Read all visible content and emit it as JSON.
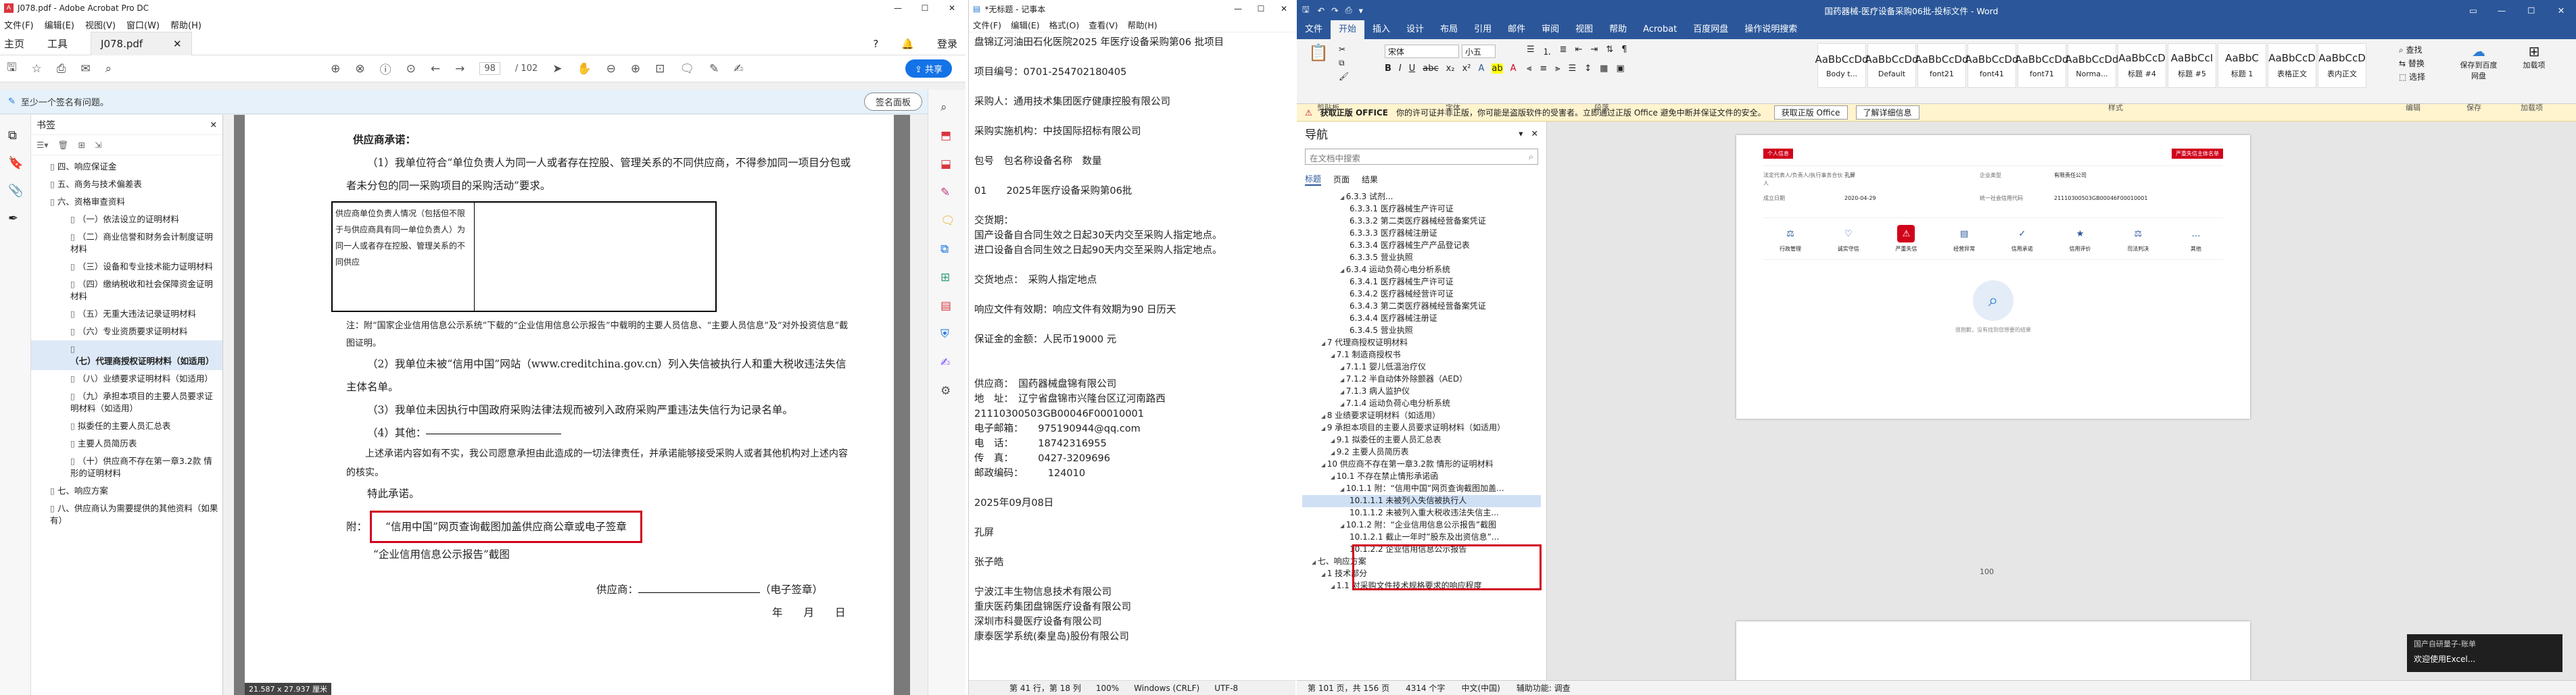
{
  "acrobat": {
    "title": "J078.pdf - Adobe Acrobat Pro DC",
    "menu": [
      "文件(F)",
      "编辑(E)",
      "视图(V)",
      "窗口(W)",
      "帮助(H)"
    ],
    "tabs": [
      "主页",
      "工具",
      "J078.pdf"
    ],
    "login": "登录",
    "page_current": "98",
    "page_total": "/ 102",
    "share": "共享",
    "notice": "至少一个签名有问题。",
    "sign_panel": "签名面板",
    "bookmarks_title": "书签",
    "bookmarks": [
      {
        "label": "四、响应保证金",
        "level": 1,
        "bold": false
      },
      {
        "label": "五、商务与技术偏差表",
        "level": 1,
        "bold": false
      },
      {
        "label": "六、资格审查资料",
        "level": 1,
        "bold": false
      },
      {
        "label": "（一）依法设立的证明材料",
        "level": 2,
        "bold": false
      },
      {
        "label": "（二）商业信誉和财务会计制度证明材料",
        "level": 2,
        "bold": false
      },
      {
        "label": "（三）设备和专业技术能力证明材料",
        "level": 2,
        "bold": false
      },
      {
        "label": "（四）缴纳税收和社会保障资金证明材料",
        "level": 2,
        "bold": false
      },
      {
        "label": "（五）无重大违法记录证明材料",
        "level": 2,
        "bold": false
      },
      {
        "label": "（六）专业资质要求证明材料",
        "level": 2,
        "bold": false
      },
      {
        "label": "（七）代理商授权证明材料（如适用）",
        "level": 2,
        "bold": true
      },
      {
        "label": "（八）业绩要求证明材料（如适用）",
        "level": 2,
        "bold": false
      },
      {
        "label": "（九）承担本项目的主要人员要求证明材料（如适用）",
        "level": 2,
        "bold": false
      },
      {
        "label": "拟委任的主要人员汇总表",
        "level": 2,
        "bold": false
      },
      {
        "label": "主要人员简历表",
        "level": 2,
        "bold": false
      },
      {
        "label": "（十）供应商不存在第一章3.2款 情形的证明材料",
        "level": 2,
        "bold": false
      },
      {
        "label": "七、响应方案",
        "level": 1,
        "bold": false
      },
      {
        "label": "八、供应商认为需要提供的其他资料（如果有）",
        "level": 1,
        "bold": false
      }
    ],
    "page": {
      "heading": "供应商承诺：",
      "p1": "（1）我单位符合“单位负责人为同一人或者存在控股、管理关系的不同供应商，不得参加同一项目分包或者未分包的同一采购项目的采购活动”要求。",
      "table_left": "供应商单位负责人情况（包括但不限于与供应商具有同一单位负责人）为同一人或者存在控股、管理关系的不同供应",
      "note": "注：附“国家企业信用信息公示系统”下载的“企业信用信息公示报告”中载明的主要人员信息、“主要人员信息”及“对外投资信息”截图证明。",
      "p2": "（2）我单位未被“信用中国”网站（www.creditchina.gov.cn）列入失信被执行人和重大税收违法失信主体名单。",
      "p3": "（3）我单位未因执行中国政府采购法律法规而被列入政府采购严重违法失信行为记录名单。",
      "p4": "（4）其他：",
      "p5": "上述承诺内容如有不实，我公司愿意承担由此造成的一切法律责任，并承诺能够接受采购人或者其他机构对上述内容的核实。",
      "p6": "特此承诺。",
      "att_prefix": "附：",
      "att1": "“信用中国”网页查询截图加盖供应商公章或电子签章",
      "att2": "“企业信用信息公示报告”截图",
      "sign": "供应商：",
      "sign_suffix": "（电子签章）",
      "date": "年　　月　　日"
    },
    "page_size": "21.587 x 27.937 厘米"
  },
  "notepad": {
    "title": "*无标题 - 记事本",
    "menu": [
      "文件(F)",
      "编辑(E)",
      "格式(O)",
      "查看(V)",
      "帮助(H)"
    ],
    "lines": [
      "盘锦辽河油田石化医院2025 年医疗设备采购第06 批项目",
      "",
      "项目编号：0701-254702180405",
      "",
      "采购人：通用技术集团医疗健康控股有限公司",
      "",
      "采购实施机构：中技国际招标有限公司",
      "",
      "包号　包名称设备名称　数量",
      "",
      "01　　2025年医疗设备采购第06批",
      "",
      "交货期：",
      "国产设备自合同生效之日起30天内交至采购人指定地点。",
      "进口设备自合同生效之日起90天内交至采购人指定地点。",
      "",
      "交货地点：　采购人指定地点",
      "",
      "响应文件有效期：响应文件有效期为90 日历天",
      "",
      "保证金的金额：人民币19000 元",
      "",
      "",
      "供应商：　国药器械盘锦有限公司",
      "地　址：　辽宁省盘锦市兴隆台区辽河南路西",
      "21110300503GB00046F00010001",
      "电子邮箱：　　975190944@qq.com",
      "电　话：　　　18742316955",
      "传　真：　　　0427-3209696",
      "邮政编码：　　　124010",
      "",
      "2025年09月08日",
      "",
      "孔屏",
      "",
      "张子皓",
      "",
      "宁波江丰生物信息技术有限公司",
      "重庆医药集团盘锦医疗设备有限公司",
      "深圳市科曼医疗设备有限公司",
      "康泰医学系统(秦皇岛)股份有限公司"
    ],
    "status": [
      "第 41 行，第 18 列",
      "100%",
      "Windows (CRLF)",
      "UTF-8"
    ]
  },
  "word": {
    "title": "国药器械-医疗设备采购06批-投标文件 - Word",
    "tabs": [
      "文件",
      "开始",
      "插入",
      "设计",
      "布局",
      "引用",
      "邮件",
      "审阅",
      "视图",
      "帮助",
      "Acrobat",
      "百度网盘",
      "操作说明搜索"
    ],
    "active_tab": "开始",
    "font_name": "宋体",
    "font_size": "小五",
    "styles": [
      {
        "preview": "AaBbCcDd",
        "label": "Body t..."
      },
      {
        "preview": "AaBbCcDd",
        "label": "Default"
      },
      {
        "preview": "AaBbCcDd",
        "label": "font21"
      },
      {
        "preview": "AaBbCcDd",
        "label": "font41"
      },
      {
        "preview": "AaBbCcDd",
        "label": "font71"
      },
      {
        "preview": "AaBbCcDd",
        "label": "Norma..."
      },
      {
        "preview": "AaBbCcD",
        "label": "标题 #4"
      },
      {
        "preview": "AaBbCcI",
        "label": "标题 #5"
      },
      {
        "preview": "AaBbC",
        "label": "标题 1"
      },
      {
        "preview": "AaBbCcD",
        "label": "表格正文"
      },
      {
        "preview": "AaBbCcD",
        "label": "表内正文"
      }
    ],
    "groups": [
      "剪贴板",
      "字体",
      "段落",
      "样式",
      "编辑",
      "保存",
      "加载项"
    ],
    "find": "查找",
    "replace": "替换",
    "select": "选择",
    "save_btn": "保存到百度网盘",
    "addins": "加载项",
    "msg_bold": "获取正版 OFFICE",
    "msg": "你的许可证并非正版，你可能是盗版软件的受害者。立即通过正版 Office 避免中断并保证文件的安全。",
    "msg_btn1": "获取正版 Office",
    "msg_btn2": "了解详细信息",
    "nav_title": "导航",
    "nav_search": "在文档中搜索",
    "nav_tabs": [
      "标题",
      "页面",
      "结果"
    ],
    "nav_items": [
      {
        "t": "6.3.3 试剂...",
        "l": 4
      },
      {
        "t": "6.3.3.1 医疗器械生产许可证",
        "l": 5
      },
      {
        "t": "6.3.3.2 第二类医疗器械经营备案凭证",
        "l": 5
      },
      {
        "t": "6.3.3.3 医疗器械注册证",
        "l": 5
      },
      {
        "t": "6.3.3.4 医疗器械生产产品登记表",
        "l": 5
      },
      {
        "t": "6.3.3.5 营业执照",
        "l": 5
      },
      {
        "t": "6.3.4 运动负荷心电分析系统",
        "l": 4
      },
      {
        "t": "6.3.4.1 医疗器械生产许可证",
        "l": 5
      },
      {
        "t": "6.3.4.2 医疗器械经营许可证",
        "l": 5
      },
      {
        "t": "6.3.4.3 第二类医疗器械经营备案凭证",
        "l": 5
      },
      {
        "t": "6.3.4.4 医疗器械注册证",
        "l": 5
      },
      {
        "t": "6.3.4.5 营业执照",
        "l": 5
      },
      {
        "t": "7 代理商授权证明材料",
        "l": 2
      },
      {
        "t": "7.1 制造商授权书",
        "l": 3
      },
      {
        "t": "7.1.1 婴儿低温治疗仪",
        "l": 4
      },
      {
        "t": "7.1.2 半自动体外除颤器（AED）",
        "l": 4
      },
      {
        "t": "7.1.3 病人监护仪",
        "l": 4
      },
      {
        "t": "7.1.4 运动负荷心电分析系统",
        "l": 4
      },
      {
        "t": "8 业绩要求证明材料（如适用）",
        "l": 2
      },
      {
        "t": "9 承担本项目的主要人员要求证明材料（如适用）",
        "l": 2
      },
      {
        "t": "9.1 拟委任的主要人员汇总表",
        "l": 3
      },
      {
        "t": "9.2 主要人员简历表",
        "l": 3
      },
      {
        "t": "10 供应商不存在第一章3.2款 情形的证明材料",
        "l": 2
      },
      {
        "t": "10.1 不存在禁止情形承诺函",
        "l": 3
      },
      {
        "t": "10.1.1 附：“信用中国”网页查询截图加盖...",
        "l": 4
      },
      {
        "t": "10.1.1.1 未被列入失信被执行人",
        "l": 5
      },
      {
        "t": "10.1.1.2 未被列入重大税收违法失信主...",
        "l": 5
      },
      {
        "t": "10.1.2 附：“企业信用信息公示报告”截图",
        "l": 4
      },
      {
        "t": "10.1.2.1 截止一年时”股东及出资信息”...",
        "l": 5
      },
      {
        "t": "10.1.2.2 企业信用信息公示报告",
        "l": 5
      },
      {
        "t": "七、响应方案",
        "l": 1
      },
      {
        "t": "1 技术部分",
        "l": 2
      },
      {
        "t": "1.1 对采购文件技术规格要求的响应程度",
        "l": 3
      }
    ],
    "nav_selected": "10.1.1.1 未被列入失信被执行人",
    "credit_page": {
      "badge": "个人信息",
      "company_label": "法定代表人/负责人/执行事务合伙人",
      "company_value": "孔屏",
      "type_label": "企业类型",
      "type_value": "有限责任公司",
      "date_label": "成立日期",
      "date_value": "2020-04-29",
      "code_label": "统一社会信用代码",
      "code_value": "21110300503GB00046F00010001",
      "stamp": "严重失信主体名单",
      "icons": [
        "行政管理",
        "诚实守信",
        "严重失信",
        "经营异常",
        "信用承诺",
        "信用评价",
        "司法判决",
        "其他"
      ],
      "empty": "很抱歉，没有找到您想要的结果",
      "page_no": "100"
    },
    "toast_title": "国产自研量子-账单",
    "toast_text": "欢迎使用Excel...",
    "status": [
      "第 101 页，共 156 页",
      "4314 个字",
      "中文(中国)",
      "辅助功能: 调查"
    ]
  },
  "colors": {
    "word_blue": "#2b579a",
    "acro_blue": "#1473e6",
    "red": "#d0021b"
  }
}
